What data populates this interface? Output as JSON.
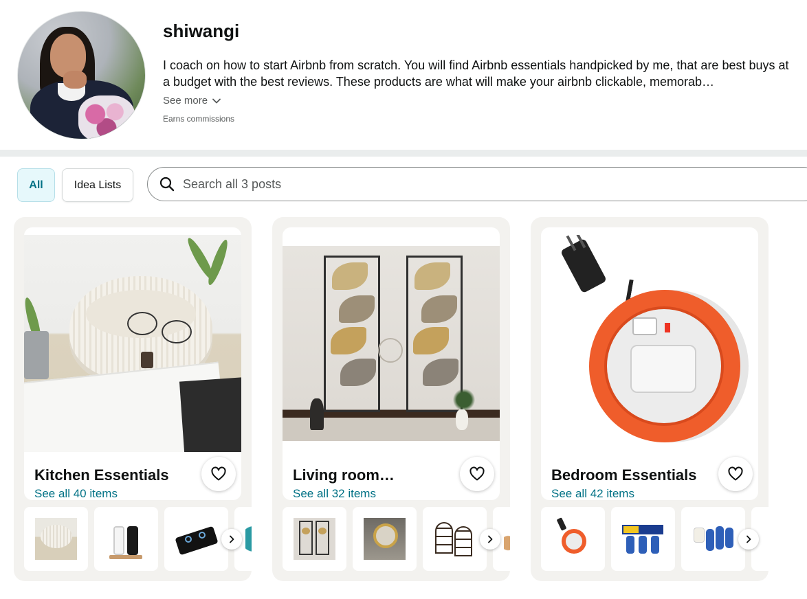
{
  "profile": {
    "name": "shiwangi",
    "bio": "I coach on how to start Airbnb from scratch. You will find Airbnb essentials handpicked by me, that are best buys at a budget with the best reviews. These products are what will make your airbnb clickable, memorab…",
    "see_more_label": "See more",
    "earns_label": "Earns commissions"
  },
  "filters": {
    "all_label": "All",
    "idea_lists_label": "Idea Lists"
  },
  "search": {
    "placeholder": "Search all 3 posts",
    "value": ""
  },
  "cards": [
    {
      "title": "Kitchen Essentials",
      "link": "See all 40 items",
      "image": "rope-basket-photo",
      "thumbs": [
        "basket-thumb",
        "soap-dispenser-thumb",
        "gas-stove-thumb"
      ]
    },
    {
      "title": "Living room…",
      "link": "See all 32 items",
      "image": "metal-wall-art-photo",
      "thumbs": [
        "wall-art-thumb",
        "round-mirror-thumb",
        "arched-mirror-thumb"
      ]
    },
    {
      "title": "Bedroom Essentials",
      "link": "See all 42 items",
      "image": "extension-reel-photo",
      "thumbs": [
        "extension-reel-thumb",
        "mosquito-repellent-pack-thumb",
        "repellent-refills-thumb"
      ]
    }
  ],
  "icons": {
    "search": "search-icon",
    "chevron_down": "chevron-down-icon",
    "heart": "heart-outline-icon",
    "chevron_right": "chevron-right-icon"
  },
  "colors": {
    "link": "#007185",
    "selected_pill_bg": "#e6f8fb",
    "card_bg": "#f3f2ef",
    "divider": "#eaeded"
  }
}
